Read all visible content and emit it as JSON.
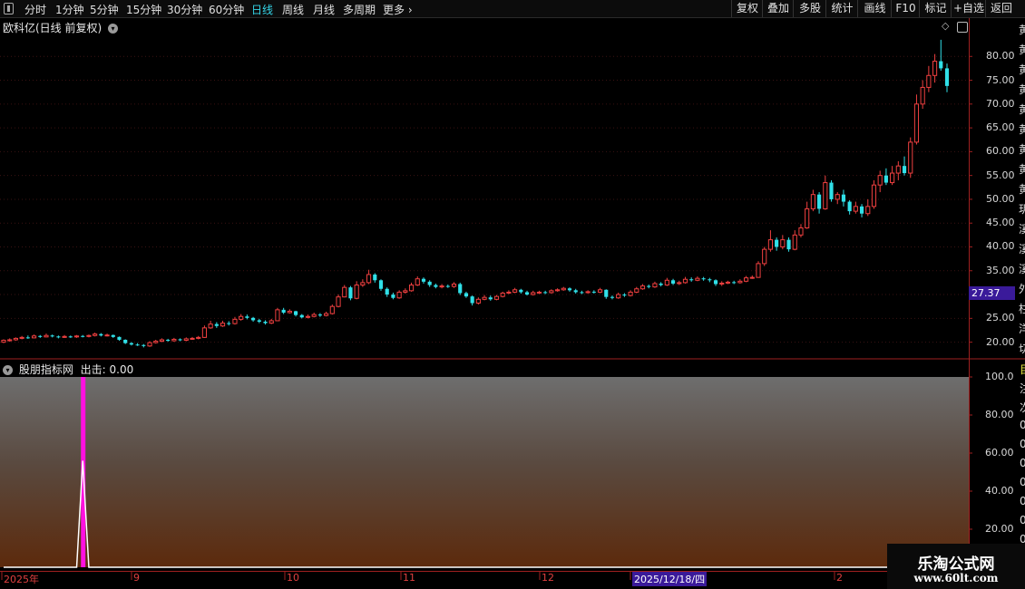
{
  "toolbar": {
    "left_items": [
      {
        "label": "分时",
        "active": false
      },
      {
        "label": "1分钟",
        "active": false
      },
      {
        "label": "5分钟",
        "active": false
      },
      {
        "label": "15分钟",
        "active": false
      },
      {
        "label": "30分钟",
        "active": false
      },
      {
        "label": "60分钟",
        "active": false
      },
      {
        "label": "日线",
        "active": true
      },
      {
        "label": "周线",
        "active": false
      },
      {
        "label": "月线",
        "active": false
      },
      {
        "label": "多周期",
        "active": false
      },
      {
        "label": "更多",
        "active": false
      }
    ],
    "right_items": [
      "复权",
      "叠加",
      "多股",
      "统计",
      "画线",
      "F10",
      "标记",
      "+自选",
      "返回"
    ]
  },
  "main_chart": {
    "title": "欧科亿(日线 前复权)",
    "price_ticks": [
      "80.00",
      "75.00",
      "70.00",
      "65.00",
      "60.00",
      "55.00",
      "50.00",
      "45.00",
      "40.00",
      "35.00",
      "30.00",
      "25.00",
      "20.00"
    ],
    "current_price": "27.37",
    "right_side_chars": [
      "黄",
      "黄",
      "黄",
      "黄",
      "黄",
      "黄",
      "黄",
      "黄",
      "黄",
      "玥",
      "溪",
      "溪",
      "溪",
      "外",
      "柱",
      "洋",
      "切"
    ]
  },
  "indicator": {
    "title": "股朋指标网",
    "output_label": "出击:",
    "output_value": "0.00",
    "ticks": [
      "100.0",
      "80.00",
      "60.00",
      "40.00",
      "20.00"
    ],
    "right_side_chars": [
      "目",
      "注",
      "次",
      "0",
      "0",
      "0",
      "0",
      "0",
      "0",
      "0"
    ]
  },
  "time_axis": {
    "labels": [
      "2025年",
      "9",
      "10",
      "11",
      "12",
      "2025/12/18/四",
      "2"
    ]
  },
  "watermark": {
    "title": "乐淘公式网",
    "url": "www.60lt.com"
  },
  "colors": {
    "up": "#f04040",
    "down": "#30e0e8",
    "signal": "#ff10e0",
    "active_tab": "#34d5e8",
    "price_badge": "#3a1a9a"
  },
  "chart_data": {
    "type": "candlestick",
    "price_range": [
      16.5,
      85
    ],
    "indicator_range": [
      0,
      100
    ],
    "candles": [
      [
        20.0,
        20.4,
        20.6,
        19.8
      ],
      [
        20.3,
        20.5,
        20.8,
        20.1
      ],
      [
        20.5,
        20.8,
        21.0,
        20.3
      ],
      [
        20.8,
        21.0,
        21.3,
        20.6
      ],
      [
        21.0,
        20.9,
        21.4,
        20.7
      ],
      [
        20.9,
        21.3,
        21.6,
        20.8
      ],
      [
        21.3,
        21.1,
        21.5,
        20.9
      ],
      [
        21.1,
        21.4,
        21.8,
        21.0
      ],
      [
        21.4,
        21.2,
        21.6,
        21.0
      ],
      [
        21.2,
        21.0,
        21.4,
        20.8
      ],
      [
        21.0,
        21.2,
        21.5,
        20.9
      ],
      [
        21.2,
        21.1,
        21.4,
        20.9
      ],
      [
        21.1,
        21.3,
        21.5,
        20.9
      ],
      [
        21.3,
        21.2,
        21.5,
        21.0
      ],
      [
        21.2,
        21.4,
        21.6,
        21.0
      ],
      [
        21.4,
        21.7,
        22.0,
        21.2
      ],
      [
        21.7,
        21.4,
        21.9,
        21.2
      ],
      [
        21.4,
        21.5,
        21.8,
        21.2
      ],
      [
        21.5,
        21.1,
        21.6,
        20.9
      ],
      [
        21.1,
        20.5,
        21.2,
        20.3
      ],
      [
        20.5,
        19.8,
        20.6,
        19.6
      ],
      [
        19.8,
        19.5,
        20.0,
        19.3
      ],
      [
        19.5,
        19.4,
        19.8,
        19.2
      ],
      [
        19.4,
        19.2,
        19.6,
        18.9
      ],
      [
        19.2,
        19.9,
        20.2,
        19.0
      ],
      [
        19.9,
        20.2,
        20.5,
        19.7
      ],
      [
        20.2,
        20.5,
        20.8,
        20.0
      ],
      [
        20.5,
        20.3,
        20.7,
        20.1
      ],
      [
        20.3,
        20.6,
        20.9,
        20.1
      ],
      [
        20.6,
        20.4,
        20.8,
        20.2
      ],
      [
        20.4,
        20.7,
        21.0,
        20.2
      ],
      [
        20.7,
        20.8,
        21.1,
        20.5
      ],
      [
        20.8,
        21.0,
        21.3,
        20.6
      ],
      [
        21.0,
        23.0,
        23.5,
        20.9
      ],
      [
        23.0,
        23.8,
        24.5,
        22.8
      ],
      [
        23.8,
        23.4,
        24.2,
        23.0
      ],
      [
        23.4,
        24.0,
        24.5,
        23.2
      ],
      [
        24.0,
        23.9,
        24.4,
        23.5
      ],
      [
        23.9,
        24.8,
        25.3,
        23.7
      ],
      [
        24.8,
        25.4,
        25.9,
        24.5
      ],
      [
        25.4,
        25.1,
        25.8,
        24.8
      ],
      [
        25.1,
        24.6,
        25.3,
        24.3
      ],
      [
        24.6,
        24.3,
        24.9,
        24.0
      ],
      [
        24.3,
        24.0,
        24.6,
        23.7
      ],
      [
        24.0,
        24.5,
        24.9,
        23.8
      ],
      [
        24.5,
        26.8,
        27.2,
        24.4
      ],
      [
        26.8,
        26.2,
        27.2,
        25.9
      ],
      [
        26.2,
        26.5,
        26.9,
        26.0
      ],
      [
        26.5,
        25.7,
        26.6,
        25.4
      ],
      [
        25.7,
        25.2,
        25.9,
        25.0
      ],
      [
        25.2,
        25.4,
        25.8,
        25.0
      ],
      [
        25.4,
        25.8,
        26.2,
        25.2
      ],
      [
        25.8,
        25.6,
        26.1,
        25.3
      ],
      [
        25.6,
        26.0,
        26.4,
        25.4
      ],
      [
        26.0,
        27.5,
        27.9,
        25.8
      ],
      [
        27.5,
        29.5,
        30.0,
        27.3
      ],
      [
        29.5,
        31.5,
        32.0,
        29.4
      ],
      [
        31.5,
        29.2,
        31.8,
        28.8
      ],
      [
        29.2,
        32.0,
        32.8,
        29.0
      ],
      [
        32.0,
        32.5,
        33.2,
        31.6
      ],
      [
        32.5,
        34.2,
        35.2,
        32.2
      ],
      [
        34.2,
        33.0,
        34.5,
        32.5
      ],
      [
        33.0,
        31.2,
        33.2,
        30.8
      ],
      [
        31.2,
        30.0,
        31.5,
        29.5
      ],
      [
        30.0,
        29.3,
        30.4,
        29.0
      ],
      [
        29.3,
        30.5,
        30.9,
        29.1
      ],
      [
        30.5,
        30.8,
        31.3,
        30.2
      ],
      [
        30.8,
        32.0,
        32.5,
        30.6
      ],
      [
        32.0,
        33.3,
        33.8,
        31.8
      ],
      [
        33.3,
        32.7,
        33.6,
        32.3
      ],
      [
        32.7,
        32.0,
        33.0,
        31.6
      ],
      [
        32.0,
        31.6,
        32.3,
        31.3
      ],
      [
        31.6,
        31.8,
        32.2,
        31.3
      ],
      [
        31.8,
        31.7,
        32.1,
        31.4
      ],
      [
        31.7,
        32.2,
        32.6,
        31.4
      ],
      [
        32.2,
        30.3,
        32.5,
        29.9
      ],
      [
        30.3,
        29.6,
        30.6,
        29.3
      ],
      [
        29.6,
        28.2,
        29.8,
        27.7
      ],
      [
        28.2,
        29.0,
        29.4,
        27.9
      ],
      [
        29.0,
        29.4,
        29.9,
        28.8
      ],
      [
        29.4,
        29.0,
        29.8,
        28.7
      ],
      [
        29.0,
        29.6,
        29.9,
        28.8
      ],
      [
        29.6,
        30.3,
        30.6,
        29.4
      ],
      [
        30.3,
        30.5,
        30.9,
        30.1
      ],
      [
        30.5,
        31.0,
        31.4,
        30.3
      ],
      [
        31.0,
        30.5,
        31.2,
        30.2
      ],
      [
        30.5,
        30.0,
        30.8,
        29.8
      ],
      [
        30.0,
        30.4,
        30.8,
        29.8
      ],
      [
        30.4,
        30.5,
        30.8,
        30.1
      ],
      [
        30.5,
        30.4,
        30.8,
        30.1
      ],
      [
        30.4,
        30.8,
        31.1,
        30.2
      ],
      [
        30.8,
        31.0,
        31.3,
        30.6
      ],
      [
        31.0,
        31.3,
        31.6,
        30.8
      ],
      [
        31.3,
        30.9,
        31.5,
        30.6
      ],
      [
        30.9,
        30.5,
        31.2,
        30.2
      ],
      [
        30.5,
        30.4,
        30.8,
        30.1
      ],
      [
        30.4,
        30.6,
        30.9,
        30.2
      ],
      [
        30.6,
        30.5,
        30.9,
        30.2
      ],
      [
        30.5,
        31.0,
        31.4,
        30.3
      ],
      [
        31.0,
        29.5,
        31.1,
        29.1
      ],
      [
        29.5,
        29.3,
        29.8,
        29.0
      ],
      [
        29.3,
        30.0,
        30.4,
        29.1
      ],
      [
        30.0,
        29.8,
        30.3,
        29.5
      ],
      [
        29.8,
        30.5,
        30.9,
        29.6
      ],
      [
        30.5,
        31.2,
        31.6,
        30.3
      ],
      [
        31.2,
        31.8,
        32.2,
        31.0
      ],
      [
        31.8,
        31.6,
        32.1,
        31.3
      ],
      [
        31.6,
        32.3,
        32.7,
        31.4
      ],
      [
        32.3,
        32.0,
        32.6,
        31.7
      ],
      [
        32.0,
        33.0,
        33.5,
        31.8
      ],
      [
        33.0,
        32.3,
        33.3,
        32.0
      ],
      [
        32.3,
        32.5,
        32.9,
        32.0
      ],
      [
        32.5,
        33.2,
        33.7,
        32.3
      ],
      [
        33.2,
        33.0,
        33.6,
        32.7
      ],
      [
        33.0,
        33.4,
        33.8,
        32.8
      ],
      [
        33.4,
        33.2,
        33.7,
        32.9
      ],
      [
        33.2,
        33.0,
        33.5,
        32.6
      ],
      [
        33.0,
        32.2,
        33.2,
        31.8
      ],
      [
        32.2,
        32.4,
        32.8,
        31.8
      ],
      [
        32.4,
        32.6,
        32.9,
        32.2
      ],
      [
        32.6,
        32.5,
        32.9,
        32.2
      ],
      [
        32.5,
        32.8,
        33.2,
        32.3
      ],
      [
        32.8,
        33.5,
        33.9,
        32.6
      ],
      [
        33.5,
        33.6,
        34.0,
        33.3
      ],
      [
        33.6,
        36.5,
        37.0,
        33.5
      ],
      [
        36.5,
        39.5,
        40.0,
        36.0
      ],
      [
        39.5,
        41.5,
        43.5,
        39.0
      ],
      [
        41.5,
        40.0,
        42.0,
        39.2
      ],
      [
        40.0,
        41.5,
        42.5,
        39.5
      ],
      [
        41.5,
        39.5,
        42.0,
        39.0
      ],
      [
        39.5,
        42.5,
        43.5,
        39.3
      ],
      [
        42.5,
        44.0,
        44.8,
        42.0
      ],
      [
        44.0,
        48.0,
        49.5,
        43.8
      ],
      [
        48.0,
        51.0,
        52.0,
        47.5
      ],
      [
        51.0,
        48.0,
        51.5,
        47.0
      ],
      [
        48.0,
        53.5,
        55.0,
        47.8
      ],
      [
        53.5,
        50.0,
        54.0,
        49.5
      ],
      [
        50.0,
        51.0,
        51.5,
        49.0
      ],
      [
        51.0,
        49.5,
        52.0,
        48.5
      ],
      [
        49.5,
        47.5,
        49.8,
        46.8
      ],
      [
        47.5,
        48.5,
        49.5,
        47.0
      ],
      [
        48.5,
        47.0,
        49.0,
        46.2
      ],
      [
        47.0,
        48.5,
        50.0,
        46.5
      ],
      [
        48.5,
        53.0,
        54.0,
        48.0
      ],
      [
        53.0,
        55.0,
        56.0,
        51.5
      ],
      [
        55.0,
        53.5,
        56.5,
        53.0
      ],
      [
        53.5,
        55.5,
        57.0,
        53.0
      ],
      [
        55.5,
        57.0,
        58.0,
        54.0
      ],
      [
        57.0,
        55.5,
        59.0,
        55.0
      ],
      [
        55.5,
        62.0,
        63.0,
        54.5
      ],
      [
        62.0,
        70.0,
        72.0,
        61.5
      ],
      [
        70.0,
        73.5,
        75.0,
        69.0
      ],
      [
        73.5,
        76.0,
        78.0,
        72.5
      ],
      [
        76.0,
        79.0,
        80.5,
        74.5
      ],
      [
        79.0,
        77.5,
        83.5,
        77.0
      ],
      [
        77.5,
        73.8,
        78.5,
        72.5
      ]
    ],
    "signal_index": 13,
    "signal_value": 100
  }
}
